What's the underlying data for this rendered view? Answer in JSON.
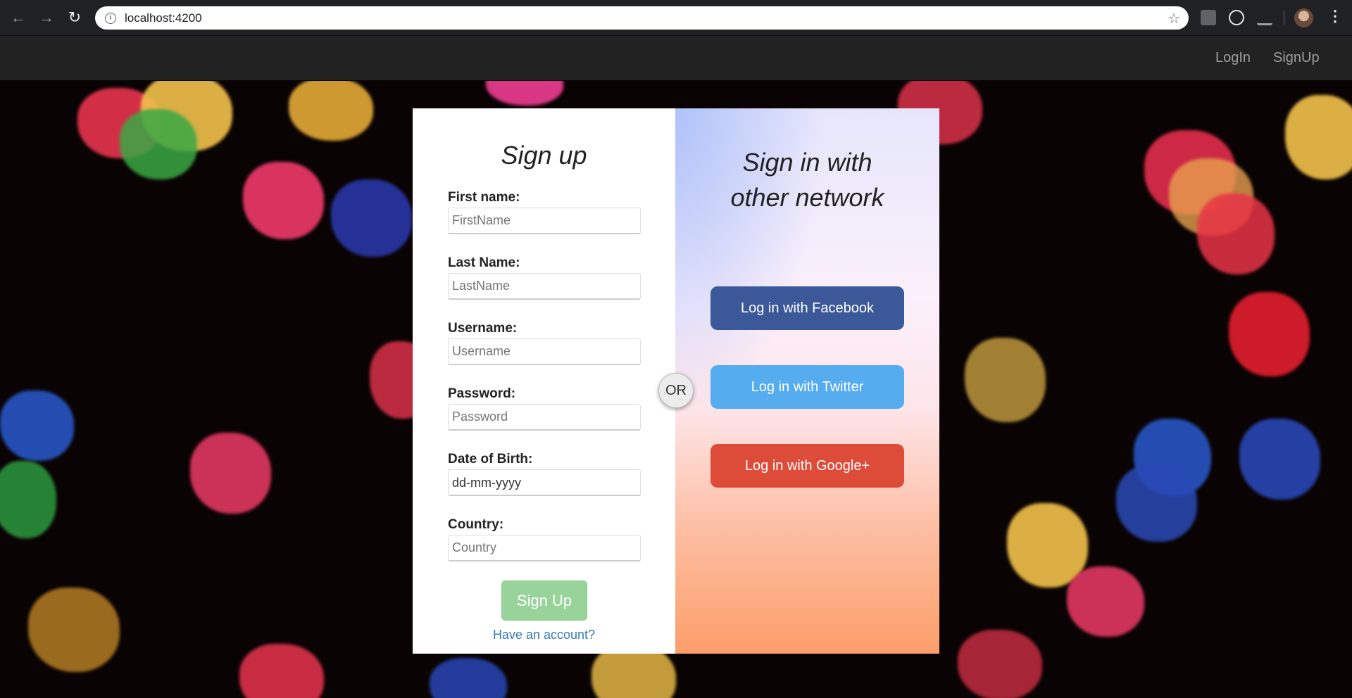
{
  "browser": {
    "url": "localhost:4200"
  },
  "navbar": {
    "login": "LogIn",
    "signup": "SignUp"
  },
  "signup_form": {
    "title": "Sign up",
    "fields": [
      {
        "label": "First name:",
        "placeholder": "FirstName"
      },
      {
        "label": "Last Name:",
        "placeholder": "LastName"
      },
      {
        "label": "Username:",
        "placeholder": "Username"
      },
      {
        "label": "Password:",
        "placeholder": "Password"
      },
      {
        "label": "Date of Birth:",
        "placeholder": "dd-mm-yyyy"
      },
      {
        "label": "Country:",
        "placeholder": "Country"
      }
    ],
    "submit": "Sign Up",
    "have_account": "Have an account?"
  },
  "divider": "OR",
  "social": {
    "title_line1": "Sign in with",
    "title_line2": "other network",
    "facebook": "Log in with Facebook",
    "twitter": "Log in with Twitter",
    "google": "Log in with Google+"
  },
  "colors": {
    "facebook": "#3b5998",
    "twitter": "#55acee",
    "google": "#dd4b39",
    "signup_button": "#98d39a",
    "link": "#337ab7"
  }
}
